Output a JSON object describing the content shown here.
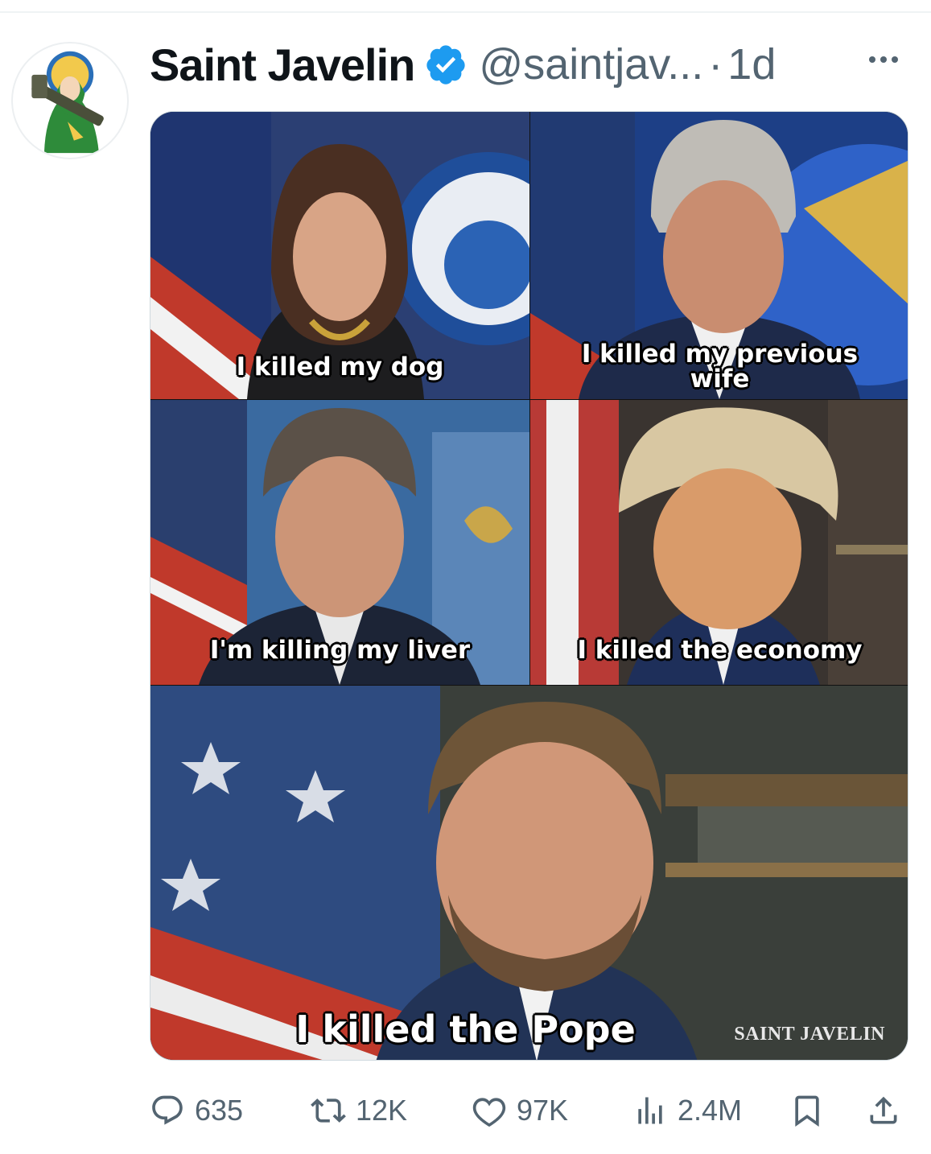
{
  "post": {
    "author": {
      "display_name": "Saint Javelin",
      "handle": "@saintjav...",
      "separator": "·",
      "time": "1d"
    },
    "media": {
      "panels": [
        {
          "caption_lines": [
            "I killed my dog"
          ]
        },
        {
          "caption_lines": [
            "I killed my previous",
            "wife"
          ]
        },
        {
          "caption_lines": [
            "I'm killing my liver"
          ]
        },
        {
          "caption_lines": [
            "I killed the economy"
          ]
        },
        {
          "caption_lines": [
            "I killed the Pope"
          ]
        }
      ],
      "watermark": "SAINT JAVELIN"
    },
    "actions": {
      "replies": "635",
      "reposts": "12K",
      "likes": "97K",
      "views": "2.4M"
    }
  },
  "icons": {
    "verified": "verified-badge-icon",
    "more": "more-icon",
    "reply": "reply-icon",
    "repost": "repost-icon",
    "like": "heart-icon",
    "views": "views-icon",
    "bookmark": "bookmark-icon",
    "share": "share-icon"
  },
  "colors": {
    "verified_blue": "#1d9bf0",
    "secondary_text": "#536471",
    "primary_text": "#0f1419",
    "avatar_green": "#2e8b3a"
  }
}
